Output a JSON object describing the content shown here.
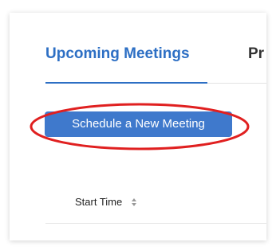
{
  "tabs": {
    "active_label": "Upcoming Meetings",
    "next_label_partial": "Pr"
  },
  "actions": {
    "schedule_label": "Schedule a New Meeting"
  },
  "table": {
    "columns": [
      "Start Time"
    ],
    "sort_icon": "sort-arrows-icon"
  },
  "colors": {
    "accent": "#2d6fc4",
    "button": "#3f79cc",
    "highlight_ring": "#e02020"
  }
}
